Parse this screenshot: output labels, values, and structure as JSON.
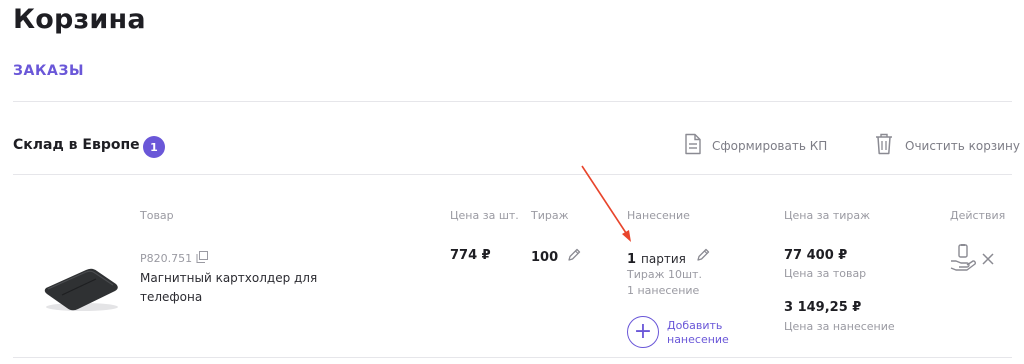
{
  "page": {
    "title": "Корзина"
  },
  "tabs": [
    {
      "label": "ЗАКАЗЫ"
    }
  ],
  "warehouse": {
    "title": "Склад в Европе",
    "count": "1",
    "actions": {
      "make_offer": "Сформировать КП",
      "clear_cart": "Очистить корзину"
    }
  },
  "table": {
    "headers": {
      "product": "Товар",
      "price_per_unit": "Цена за шт.",
      "quantity": "Тираж",
      "printing": "Нанесение",
      "total_price": "Цена за тираж",
      "actions": "Действия"
    },
    "rows": [
      {
        "sku": "P820.751",
        "name": "Магнитный картхолдер для телефона",
        "unit_price": "774 ₽",
        "quantity": "100",
        "printing": {
          "batch_count": "1",
          "batch_label": "партия",
          "run_info": "Тираж 10шт.",
          "applications": "1 нанесение",
          "add_label": "Добавить нанесение"
        },
        "totals": {
          "product_total": "77 400 ₽",
          "product_total_label": "Цена за товар",
          "printing_total": "3 149,25 ₽",
          "printing_total_label": "Цена за нанесение"
        }
      }
    ]
  },
  "colors": {
    "accent": "#6a57d8",
    "annotation_arrow": "#e8452c"
  }
}
